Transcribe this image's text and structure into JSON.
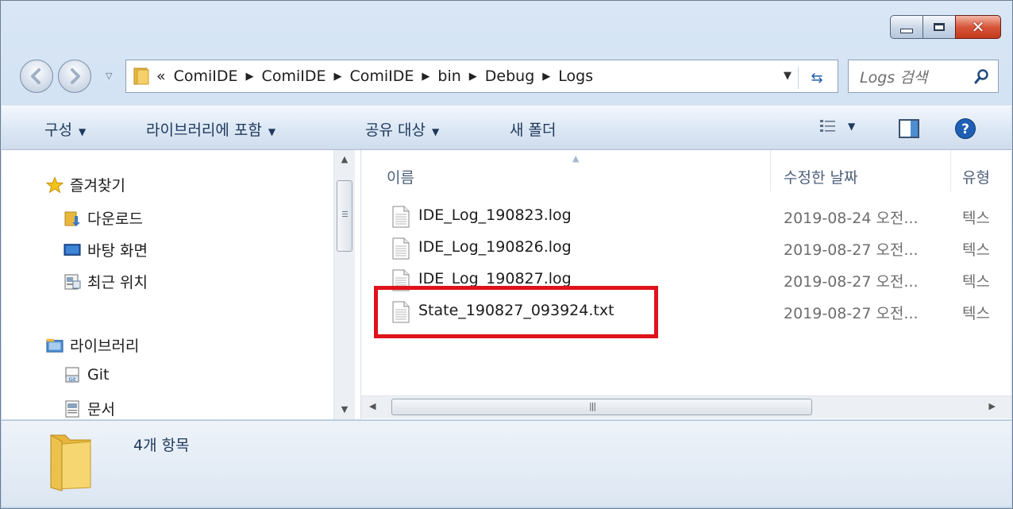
{
  "address": {
    "overflow": "«",
    "crumbs": [
      "ComiIDE",
      "ComiIDE",
      "ComiIDE",
      "bin",
      "Debug",
      "Logs"
    ],
    "search_placeholder": "Logs 검색"
  },
  "toolbar": {
    "organize": "구성",
    "include_library": "라이브러리에 포함",
    "share_with": "공유 대상",
    "new_folder": "새 폴더"
  },
  "nav": {
    "favorites": "즐겨찾기",
    "downloads": "다운로드",
    "desktop": "바탕 화면",
    "recent": "최근 위치",
    "libraries": "라이브러리",
    "git": "Git",
    "documents": "문서"
  },
  "columns": {
    "name": "이름",
    "date_modified": "수정한 날짜",
    "type": "유형"
  },
  "files": [
    {
      "name": "IDE_Log_190823.log",
      "date": "2019-08-24 오전...",
      "type": "텍스"
    },
    {
      "name": "IDE_Log_190826.log",
      "date": "2019-08-27 오전...",
      "type": "텍스"
    },
    {
      "name": "IDE_Log_190827.log",
      "date": "2019-08-27 오전...",
      "type": "텍스"
    },
    {
      "name": "State_190827_093924.txt",
      "date": "2019-08-27 오전...",
      "type": "텍스"
    }
  ],
  "details": {
    "item_count": "4개 항목"
  },
  "colors": {
    "highlight": "#e0121a",
    "toolbar_text": "#1e395b"
  }
}
